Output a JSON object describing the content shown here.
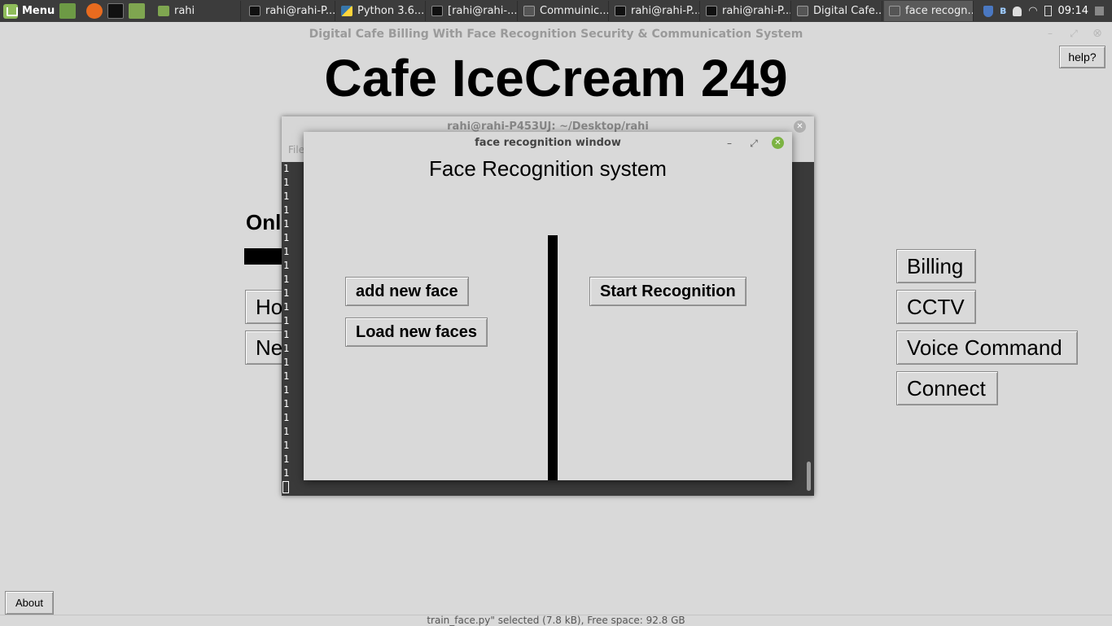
{
  "taskbar": {
    "menu_label": "Menu",
    "folder_label": "rahi",
    "tasks": [
      {
        "label": "rahi@rahi-P...",
        "icon": "terminal-icon"
      },
      {
        "label": "Python 3.6....",
        "icon": "python-icon"
      },
      {
        "label": "[rahi@rahi-...",
        "icon": "terminal-icon"
      },
      {
        "label": "Commuinic...",
        "icon": "window-icon"
      },
      {
        "label": "rahi@rahi-P...",
        "icon": "terminal-icon"
      },
      {
        "label": "rahi@rahi-P...",
        "icon": "terminal-icon"
      },
      {
        "label": "Digital Cafe...",
        "icon": "window-icon"
      },
      {
        "label": "face recogn...",
        "icon": "window-icon"
      }
    ],
    "clock": "09:14"
  },
  "main_window": {
    "title": "Digital Cafe Billing With Face Recognition Security & Communication System",
    "heading": "Cafe IceCream 249",
    "help_label": "help?",
    "online_label": "Onl",
    "left_buttons": [
      "Ho",
      "Ne"
    ],
    "right_buttons": [
      "Billing",
      "CCTV",
      "Voice Command",
      "Connect"
    ],
    "about_label": "About",
    "status_text": "train_face.py\" selected (7.8 kB), Free space: 92.8 GB"
  },
  "terminal": {
    "title": "rahi@rahi-P453UJ: ~/Desktop/rahi",
    "menu_label": "File",
    "output_line": "1"
  },
  "face_window": {
    "title": "face recognition window",
    "heading": "Face Recognition system",
    "add_label": "add new face",
    "load_label": "Load new faces",
    "start_label": "Start Recognition"
  },
  "colors": {
    "background": "#d9d9d9",
    "taskbar": "#3c3c3c",
    "close_green": "#7cb342"
  }
}
